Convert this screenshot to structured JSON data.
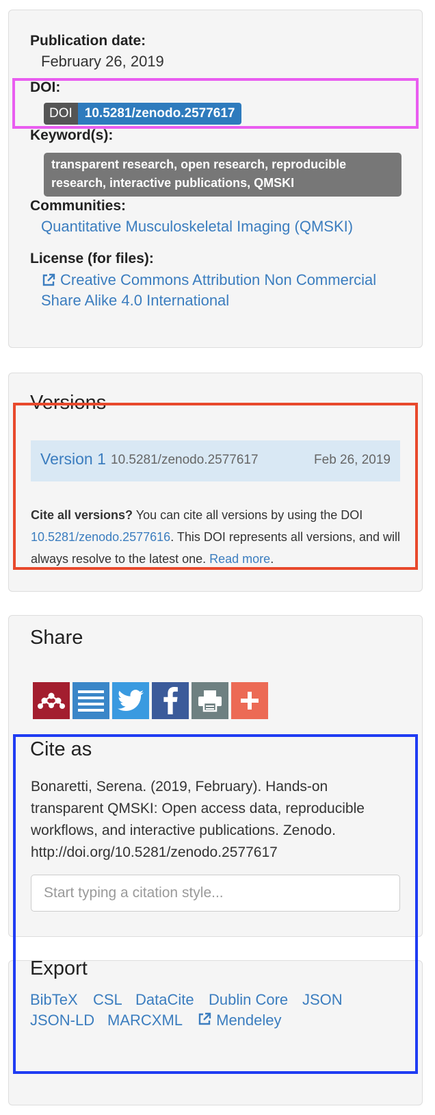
{
  "info": {
    "publication_date_label": "Publication date:",
    "publication_date": "February 26, 2019",
    "doi_label": "DOI:",
    "doi_badge_key": "DOI",
    "doi_badge_value": "10.5281/zenodo.2577617",
    "keywords_label": "Keyword(s):",
    "keywords_line1": "transparent research, open research, reproducible",
    "keywords_line2": "research, interactive publications, QMSKI",
    "communities_label": "Communities:",
    "community": "Quantitative Musculoskeletal Imaging (QMSKI)",
    "license_label": "License (for files):",
    "license_line1": "Creative Commons Attribution Non Commercial",
    "license_line2": "Share Alike 4.0 International"
  },
  "versions": {
    "title": "Versions",
    "rows": [
      {
        "name": "Version 1",
        "doi": "10.5281/zenodo.2577617",
        "date": "Feb 26, 2019"
      }
    ],
    "cite_all_bold": "Cite all versions?",
    "cite_all_text1": " You can cite all versions by using the DOI ",
    "cite_all_doi": "10.5281/zenodo.2577616",
    "cite_all_text2": ". This DOI represents all versions, and will always resolve to the latest one. ",
    "read_more": "Read more",
    "end_period": "."
  },
  "share": {
    "title": "Share",
    "buttons": [
      {
        "name": "mendeley",
        "color": "#a31e2f"
      },
      {
        "name": "list",
        "color": "#3a86c8"
      },
      {
        "name": "twitter",
        "color": "#3a9ae0"
      },
      {
        "name": "facebook",
        "color": "#3b5b9a"
      },
      {
        "name": "print",
        "color": "#6e8081"
      },
      {
        "name": "add",
        "color": "#ec6a55"
      }
    ]
  },
  "cite": {
    "title": "Cite as",
    "citation": "Bonaretti, Serena. (2019, February). Hands-on transparent QMSKI: Open access data, reproducible workflows, and interactive publications. Zenodo. http://doi.org/10.5281/zenodo.2577617",
    "style_placeholder": "Start typing a citation style..."
  },
  "export": {
    "title": "Export",
    "formats": [
      "BibTeX",
      "CSL",
      "DataCite",
      "Dublin Core",
      "JSON",
      "JSON-LD",
      "MARCXML",
      "Mendeley"
    ]
  },
  "colors": {
    "link": "#3b7dbf",
    "doi_badge": "#2e7bbd",
    "highlight_doi": "#e95df0",
    "highlight_versions": "#e8492c",
    "highlight_cite": "#1f3cf3"
  }
}
